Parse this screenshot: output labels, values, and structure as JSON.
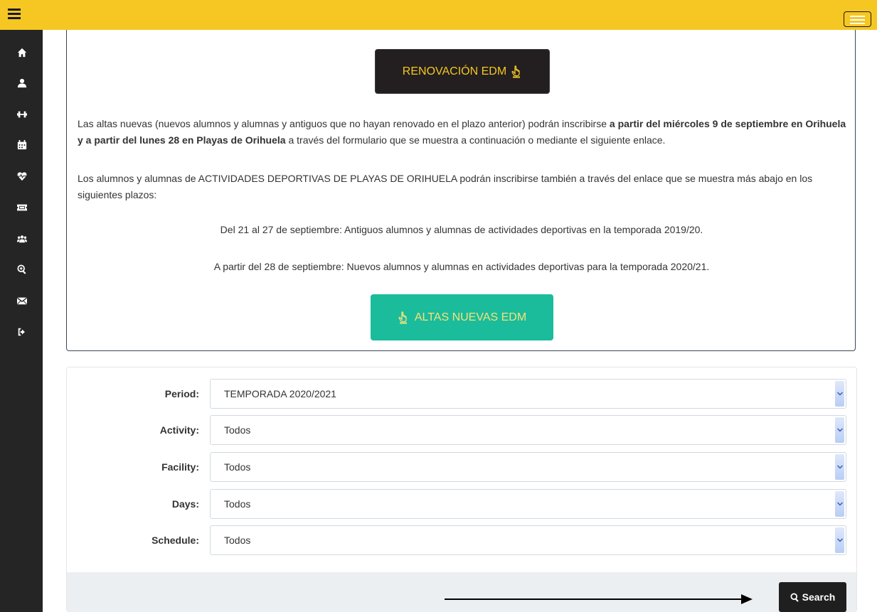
{
  "header": {
    "left_menu_icon": "hamburger-icon",
    "right_menu_icon": "hamburger-icon",
    "bar_color": "#f6c623"
  },
  "sidebar": {
    "items": [
      {
        "icon": "home-icon"
      },
      {
        "icon": "user-icon"
      },
      {
        "icon": "dumbbell-icon"
      },
      {
        "icon": "calendar-icon"
      },
      {
        "icon": "heartbeat-icon"
      },
      {
        "icon": "ticket-icon"
      },
      {
        "icon": "users-icon"
      },
      {
        "icon": "search-plus-icon"
      },
      {
        "icon": "envelope-icon"
      },
      {
        "icon": "sign-out-icon"
      }
    ]
  },
  "info": {
    "renovacion_button": "RENOVACIÓN EDM",
    "para1_text": "Las altas nuevas (nuevos alumnos y alumnas y antiguos que no hayan renovado en el plazo anterior) podrán inscribirse ",
    "para1_bold": "a partir del miércoles 9 de septiembre en Orihuela y a partir del lunes 28 en Playas de Orihuela",
    "para1_end": " a través del formulario que se muestra a continuación o mediante el siguiente enlace.",
    "para2": "Los alumnos y alumnas de ACTIVIDADES DEPORTIVAS DE PLAYAS DE ORIHUELA  podrán inscribirse también a través del enlace que se muestra más abajo en los siguientes plazos:",
    "line1": "Del 21 al 27 de septiembre: Antiguos alumnos y alumnas de actividades deportivas en la temporada 2019/20.",
    "line2": "A partir del 28 de septiembre: Nuevos alumnos y alumnas en actividades deportivas para la temporada 2020/21.",
    "altas_button": "ALTAS NUEVAS EDM"
  },
  "filters": {
    "period": {
      "label": "Period:",
      "value": "TEMPORADA 2020/2021"
    },
    "activity": {
      "label": "Activity:",
      "value": "Todos"
    },
    "facility": {
      "label": "Facility:",
      "value": "Todos"
    },
    "days": {
      "label": "Days:",
      "value": "Todos"
    },
    "schedule": {
      "label": "Schedule:",
      "value": "Todos"
    },
    "search_button": "Search"
  }
}
